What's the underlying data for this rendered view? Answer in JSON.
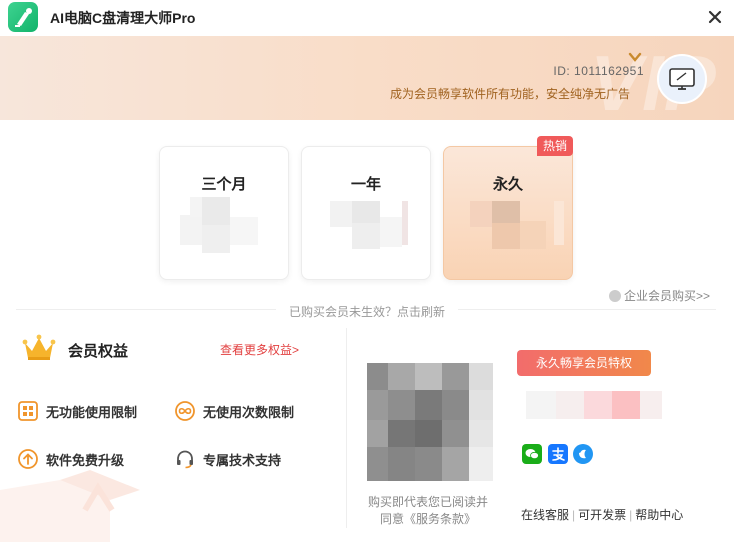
{
  "app": {
    "title": "AI电脑C盘清理大师Pro"
  },
  "banner": {
    "watermark": "VIP",
    "user_id": "ID: 1011162951",
    "description": "成为会员畅享软件所有功能，安全纯净无广告"
  },
  "plans": [
    {
      "name": "三个月"
    },
    {
      "name": "一年"
    },
    {
      "name": "永久",
      "badge": "热销",
      "selected": true
    }
  ],
  "refresh_text": "已购买会员未生效？点击刷新",
  "enterprise_link": "企业会员购买>>",
  "benefits": {
    "title": "会员权益",
    "more_link": "查看更多权益>",
    "items": [
      {
        "label": "无功能使用限制",
        "icon": "grid-icon"
      },
      {
        "label": "无使用次数限制",
        "icon": "infinity-icon"
      },
      {
        "label": "软件免费升级",
        "icon": "upgrade-icon"
      },
      {
        "label": "专属技术支持",
        "icon": "headset-icon"
      }
    ]
  },
  "payment": {
    "vip_button": "永久畅享会员特权",
    "agreement_line1": "购买即代表您已阅读并",
    "agreement_line2_prefix": "同意",
    "agreement_link": "《服务条款》",
    "methods": [
      "wechat-pay-icon",
      "alipay-icon",
      "other-pay-icon"
    ]
  },
  "footer": {
    "links": [
      "在线客服",
      "可开发票",
      "帮助中心"
    ]
  },
  "colors": {
    "accent_red": "#f05a5a",
    "banner_text": "#a0621f",
    "wechat_green": "#1aad19",
    "alipay_blue": "#1677ff"
  }
}
